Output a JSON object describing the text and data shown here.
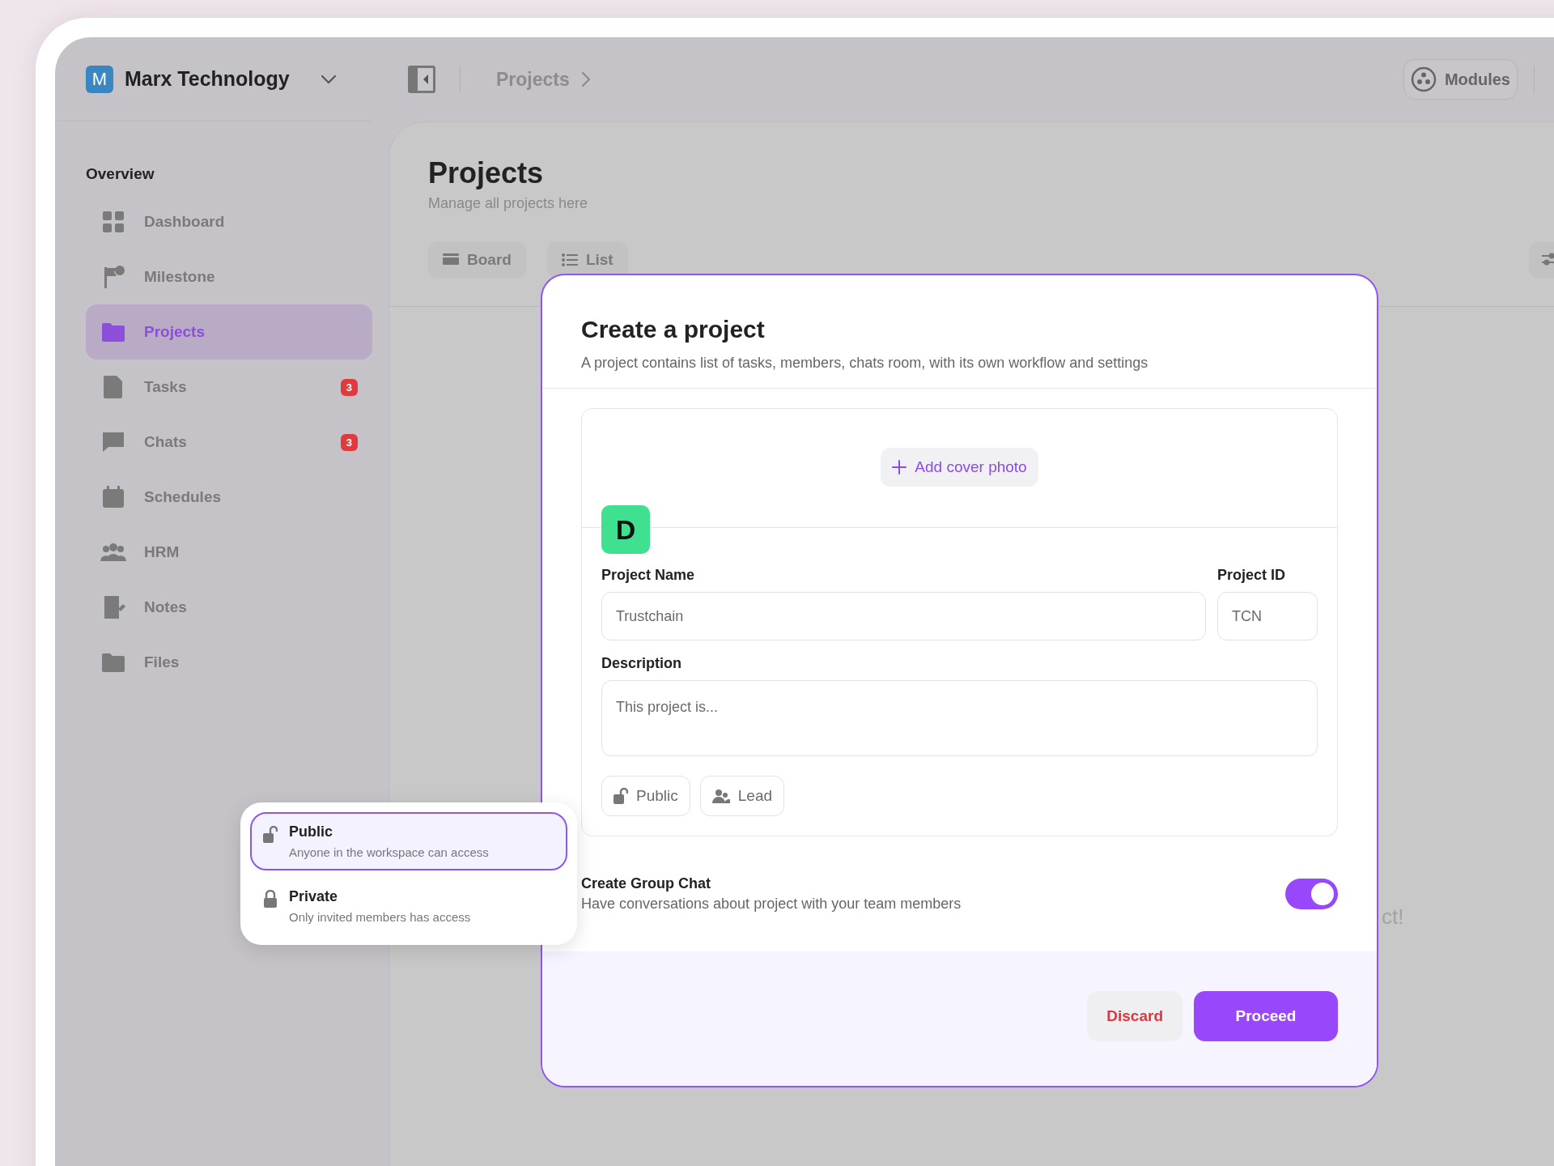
{
  "workspace": {
    "initial": "M",
    "name": "Marx Technology"
  },
  "breadcrumb": [
    "Projects"
  ],
  "modules_button": "Modules",
  "sidebar": {
    "section": "Overview",
    "items": [
      {
        "label": "Dashboard",
        "selected": false
      },
      {
        "label": "Milestone",
        "selected": false
      },
      {
        "label": "Projects",
        "selected": true
      },
      {
        "label": "Tasks",
        "selected": false,
        "badge": "3"
      },
      {
        "label": "Chats",
        "selected": false,
        "badge": "3"
      },
      {
        "label": "Schedules",
        "selected": false
      },
      {
        "label": "HRM",
        "selected": false
      },
      {
        "label": "Notes",
        "selected": false
      },
      {
        "label": "Files",
        "selected": false
      }
    ]
  },
  "page": {
    "title": "Projects",
    "subtitle": "Manage all projects here",
    "views": [
      "Board",
      "List"
    ],
    "empty_text": "ct!"
  },
  "modal": {
    "title": "Create a project",
    "subtitle": "A project contains list of tasks, members, chats room, with its own workflow and settings",
    "add_cover": "Add cover photo",
    "avatar_initial": "D",
    "project_name": {
      "label": "Project Name",
      "value": "Trustchain"
    },
    "project_id": {
      "label": "Project ID",
      "value": "TCN"
    },
    "description": {
      "label": "Description",
      "placeholder": "This project is..."
    },
    "chips": [
      "Public",
      "Lead"
    ],
    "group_chat": {
      "title": "Create Group Chat",
      "description": "Have conversations about project with your team members",
      "on": true
    },
    "buttons": {
      "discard": "Discard",
      "proceed": "Proceed"
    }
  },
  "visibility_menu": [
    {
      "title": "Public",
      "description": "Anyone in the workspace can access",
      "selected": true
    },
    {
      "title": "Private",
      "description": "Only invited members has access",
      "selected": false
    }
  ]
}
